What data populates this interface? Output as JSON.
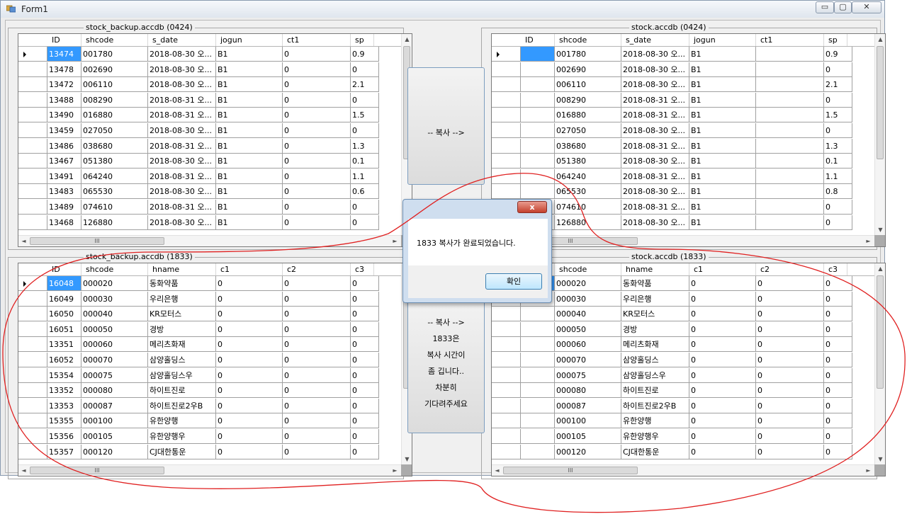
{
  "window": {
    "title": "Form1",
    "buttons": {
      "minimize": "▭",
      "maximize": "▢",
      "close": "✕"
    }
  },
  "panels": [
    {
      "caption": "stock_backup.accdb  (0424)",
      "columns": [
        "ID",
        "shcode",
        "s_date",
        "jogun",
        "ct1",
        "sp"
      ],
      "rows": [
        [
          "13474",
          "001780",
          "2018-08-30 오...",
          "B1",
          "0",
          "0.9"
        ],
        [
          "13478",
          "002690",
          "2018-08-30 오...",
          "B1",
          "0",
          "0"
        ],
        [
          "13472",
          "006110",
          "2018-08-30 오...",
          "B1",
          "0",
          "2.1"
        ],
        [
          "13488",
          "008290",
          "2018-08-31 오...",
          "B1",
          "0",
          "0"
        ],
        [
          "13490",
          "016880",
          "2018-08-31 오...",
          "B1",
          "0",
          "1.5"
        ],
        [
          "13459",
          "027050",
          "2018-08-30 오...",
          "B1",
          "0",
          "0"
        ],
        [
          "13486",
          "038680",
          "2018-08-31 오...",
          "B1",
          "0",
          "1.3"
        ],
        [
          "13467",
          "051380",
          "2018-08-30 오...",
          "B1",
          "0",
          "0.1"
        ],
        [
          "13491",
          "064240",
          "2018-08-31 오...",
          "B1",
          "0",
          "1.1"
        ],
        [
          "13483",
          "065530",
          "2018-08-30 오...",
          "B1",
          "0",
          "0.6"
        ],
        [
          "13489",
          "074610",
          "2018-08-31 오...",
          "B1",
          "0",
          "0"
        ],
        [
          "13468",
          "126880",
          "2018-08-30 오...",
          "B1",
          "0",
          "0"
        ]
      ]
    },
    {
      "caption": "stock.accdb  (0424)",
      "columns": [
        "ID",
        "shcode",
        "s_date",
        "jogun",
        "ct1",
        "sp"
      ],
      "rows": [
        [
          "",
          "001780",
          "2018-08-30 오...",
          "B1",
          "",
          "0.9"
        ],
        [
          "",
          "002690",
          "2018-08-30 오...",
          "B1",
          "",
          "0"
        ],
        [
          "",
          "006110",
          "2018-08-30 오...",
          "B1",
          "",
          "2.1"
        ],
        [
          "",
          "008290",
          "2018-08-31 오...",
          "B1",
          "",
          "0"
        ],
        [
          "",
          "016880",
          "2018-08-31 오...",
          "B1",
          "",
          "1.5"
        ],
        [
          "",
          "027050",
          "2018-08-30 오...",
          "B1",
          "",
          "0"
        ],
        [
          "",
          "038680",
          "2018-08-31 오...",
          "B1",
          "",
          "1.3"
        ],
        [
          "",
          "051380",
          "2018-08-30 오...",
          "B1",
          "",
          "0.1"
        ],
        [
          "",
          "064240",
          "2018-08-31 오...",
          "B1",
          "",
          "1.1"
        ],
        [
          "",
          "065530",
          "2018-08-30 오...",
          "B1",
          "",
          "0.8"
        ],
        [
          "",
          "074610",
          "2018-08-31 오...",
          "B1",
          "",
          "0"
        ],
        [
          "",
          "126880",
          "2018-08-30 오...",
          "B1",
          "",
          "0"
        ]
      ]
    },
    {
      "caption": "stock_backup.accdb  (1833)",
      "columns": [
        "ID",
        "shcode",
        "hname",
        "c1",
        "c2",
        "c3"
      ],
      "rows": [
        [
          "16048",
          "000020",
          "동화약품",
          "0",
          "0",
          "0"
        ],
        [
          "16049",
          "000030",
          "우리은행",
          "0",
          "0",
          "0"
        ],
        [
          "16050",
          "000040",
          "KR모터스",
          "0",
          "0",
          "0"
        ],
        [
          "16051",
          "000050",
          "경방",
          "0",
          "0",
          "0"
        ],
        [
          "13351",
          "000060",
          "메리츠화재",
          "0",
          "0",
          "0"
        ],
        [
          "16052",
          "000070",
          "삼양홀딩스",
          "0",
          "0",
          "0"
        ],
        [
          "15354",
          "000075",
          "삼양홀딩스우",
          "0",
          "0",
          "0"
        ],
        [
          "13352",
          "000080",
          "하이트진로",
          "0",
          "0",
          "0"
        ],
        [
          "13353",
          "000087",
          "하이트진로2우B",
          "0",
          "0",
          "0"
        ],
        [
          "15355",
          "000100",
          "유한양행",
          "0",
          "0",
          "0"
        ],
        [
          "15356",
          "000105",
          "유한양행우",
          "0",
          "0",
          "0"
        ],
        [
          "15357",
          "000120",
          "CJ대한통운",
          "0",
          "0",
          "0"
        ]
      ]
    },
    {
      "caption": "stock.accdb  (1833)",
      "columns": [
        "ID",
        "shcode",
        "hname",
        "c1",
        "c2",
        "c3"
      ],
      "rows": [
        [
          "",
          "000020",
          "동화약품",
          "0",
          "0",
          "0"
        ],
        [
          "",
          "000030",
          "우리은행",
          "0",
          "0",
          "0"
        ],
        [
          "",
          "000040",
          "KR모터스",
          "0",
          "0",
          "0"
        ],
        [
          "",
          "000050",
          "경방",
          "0",
          "0",
          "0"
        ],
        [
          "",
          "000060",
          "메리츠화재",
          "0",
          "0",
          "0"
        ],
        [
          "",
          "000070",
          "삼양홀딩스",
          "0",
          "0",
          "0"
        ],
        [
          "",
          "000075",
          "삼양홀딩스우",
          "0",
          "0",
          "0"
        ],
        [
          "",
          "000080",
          "하이트진로",
          "0",
          "0",
          "0"
        ],
        [
          "",
          "000087",
          "하이트진로2우B",
          "0",
          "0",
          "0"
        ],
        [
          "",
          "000100",
          "유한양행",
          "0",
          "0",
          "0"
        ],
        [
          "",
          "000105",
          "유한양행우",
          "0",
          "0",
          "0"
        ],
        [
          "",
          "000120",
          "CJ대한통운",
          "0",
          "0",
          "0"
        ]
      ]
    }
  ],
  "copy_button_top": {
    "label": "-- 복사 -->"
  },
  "copy_button_bottom": {
    "lines": [
      "-- 복사 -->",
      "1833은",
      "복사 시간이",
      "좀 깁니다..",
      "차분히",
      "기다려주세요"
    ]
  },
  "dialog": {
    "message": "1833 복사가 완료되었습니다.",
    "ok_label": "확인",
    "close_label": "x"
  },
  "scrollbar": {
    "thumb_grip": "III"
  },
  "colors": {
    "selection": "#3399ff",
    "annotation": "#e02020"
  }
}
